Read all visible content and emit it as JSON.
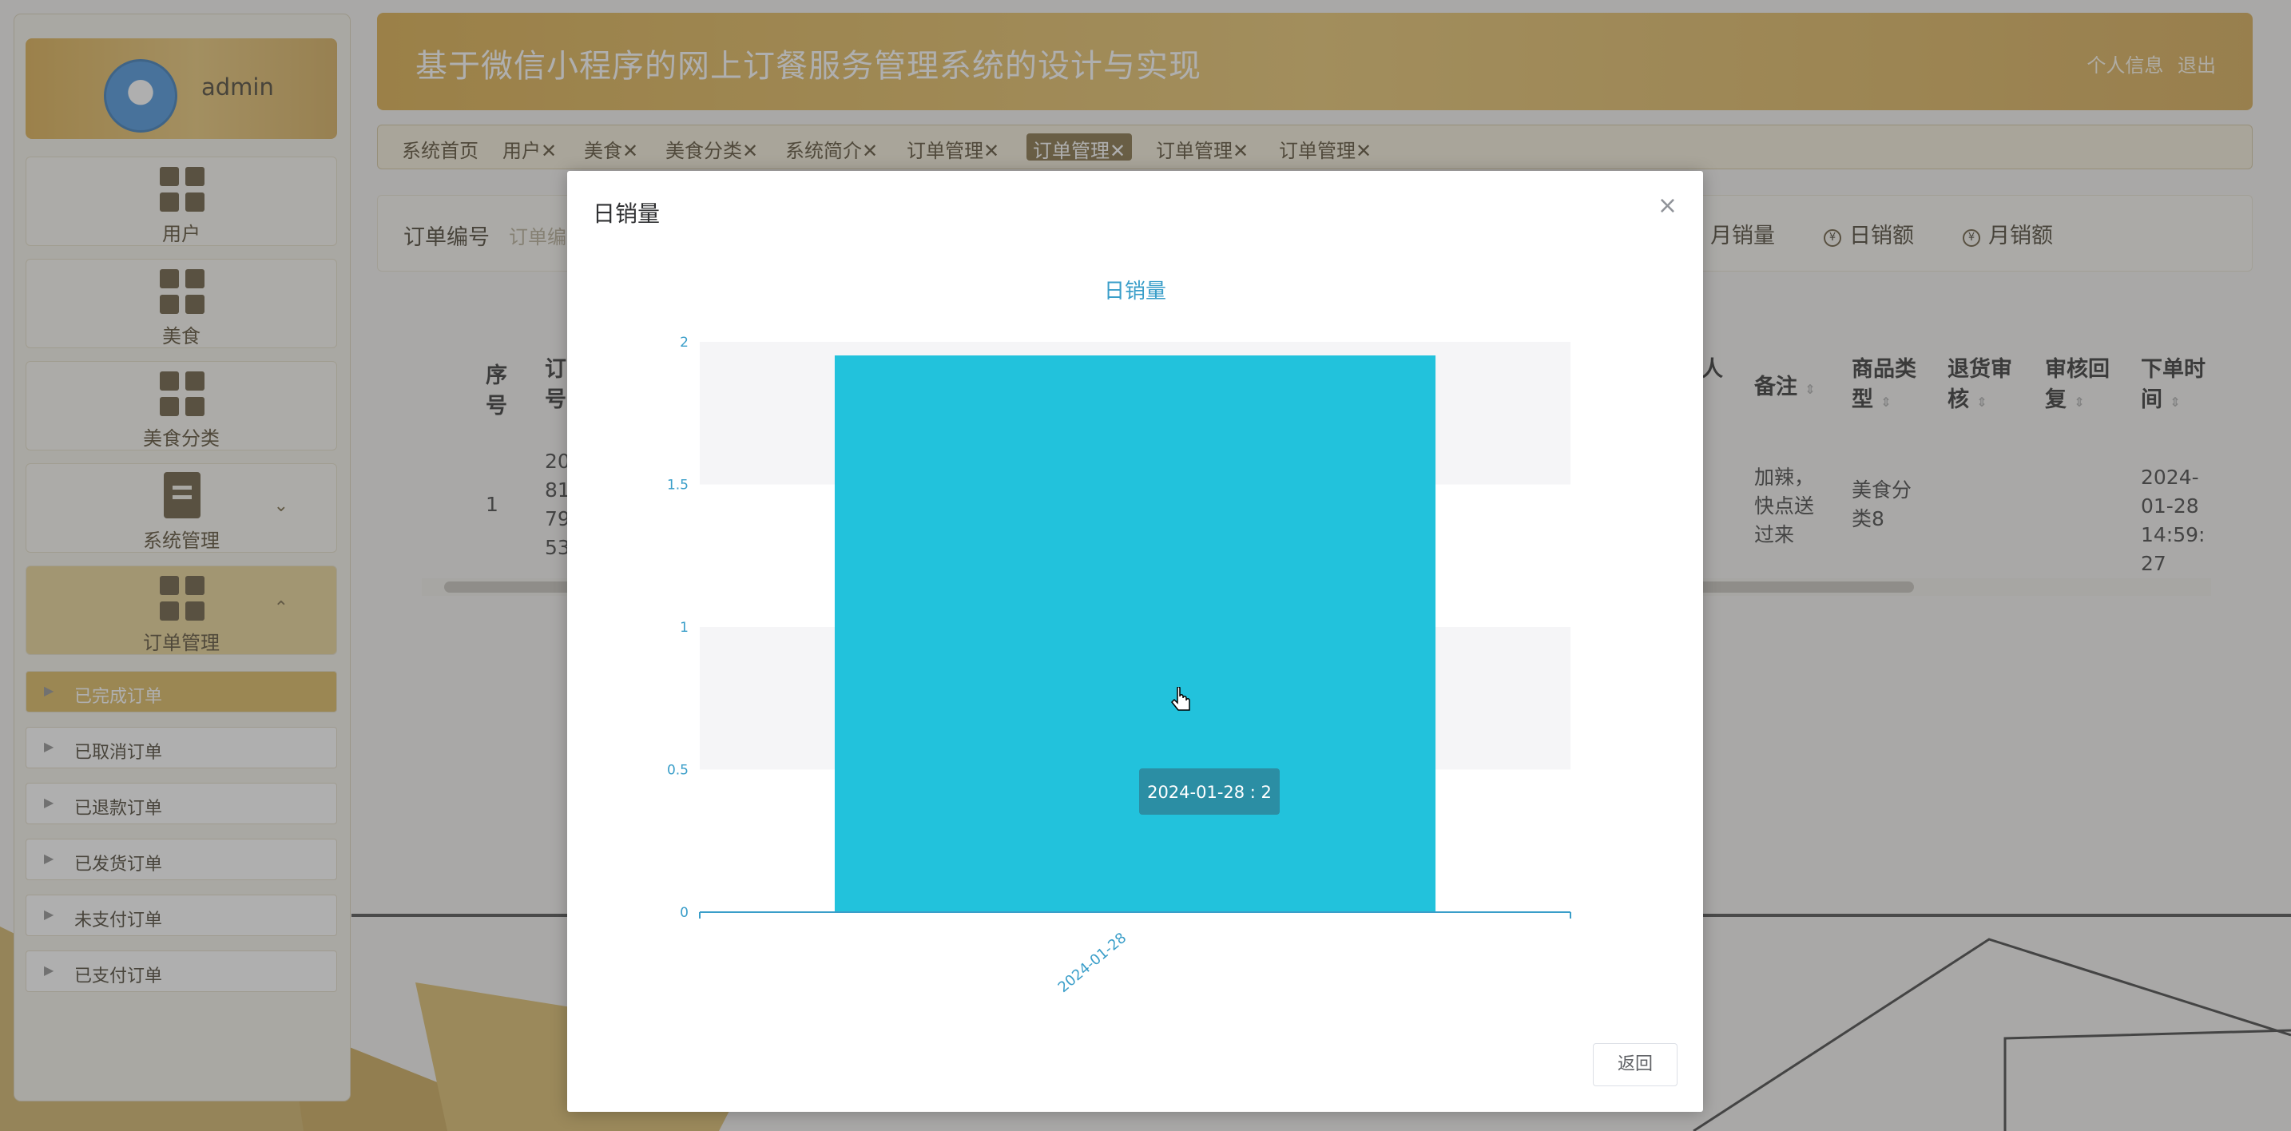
{
  "app": {
    "title": "基于微信小程序的网上订餐服务管理系统的设计与实现",
    "header_links": [
      "个人信息",
      "退出"
    ],
    "user": {
      "name": "admin"
    }
  },
  "sidebar": {
    "items": [
      {
        "label": "用户",
        "icon": "grid-icon"
      },
      {
        "label": "美食",
        "icon": "grid-icon"
      },
      {
        "label": "美食分类",
        "icon": "grid-icon"
      },
      {
        "label": "系统管理",
        "icon": "clipboard-icon"
      },
      {
        "label": "订单管理",
        "icon": "grid-icon"
      }
    ],
    "submenu": [
      "已完成订单",
      "已取消订单",
      "已退款订单",
      "已发货订单",
      "未支付订单",
      "已支付订单"
    ]
  },
  "tabs": [
    "系统首页",
    "用户✕",
    "美食✕",
    "美食分类✕",
    "系统简介✕",
    "订单管理✕",
    "订单管理✕",
    "订单管理✕",
    "订单管理✕"
  ],
  "search": {
    "label": "订单编号",
    "placeholder": "订单编",
    "buttons": [
      "月销量",
      "日销额",
      "月销额"
    ]
  },
  "table": {
    "headers": [
      "序号",
      "订号",
      "人",
      "备注",
      "商品类型",
      "退货审核",
      "审核回复",
      "下单时间"
    ],
    "row": {
      "index": "1",
      "order_no": "20\n81\n79\n53",
      "remark": "加辣，快点送过来",
      "category": "美食分类8",
      "order_time": "2024-01-28 14:59:27"
    }
  },
  "modal": {
    "title": "日销量",
    "close": "×",
    "return_label": "返回"
  },
  "chart_data": {
    "type": "bar",
    "title": "日销量",
    "categories": [
      "2024-01-28"
    ],
    "values": [
      2
    ],
    "xlabel": "",
    "ylabel": "",
    "ylim": [
      0,
      2
    ],
    "yticks": [
      "0",
      "0.5",
      "1",
      "1.5",
      "2"
    ],
    "tooltip": "2024-01-28 : 2",
    "bar_color": "#22c2dc",
    "axis_color": "#3a9ec9",
    "grid": true
  }
}
